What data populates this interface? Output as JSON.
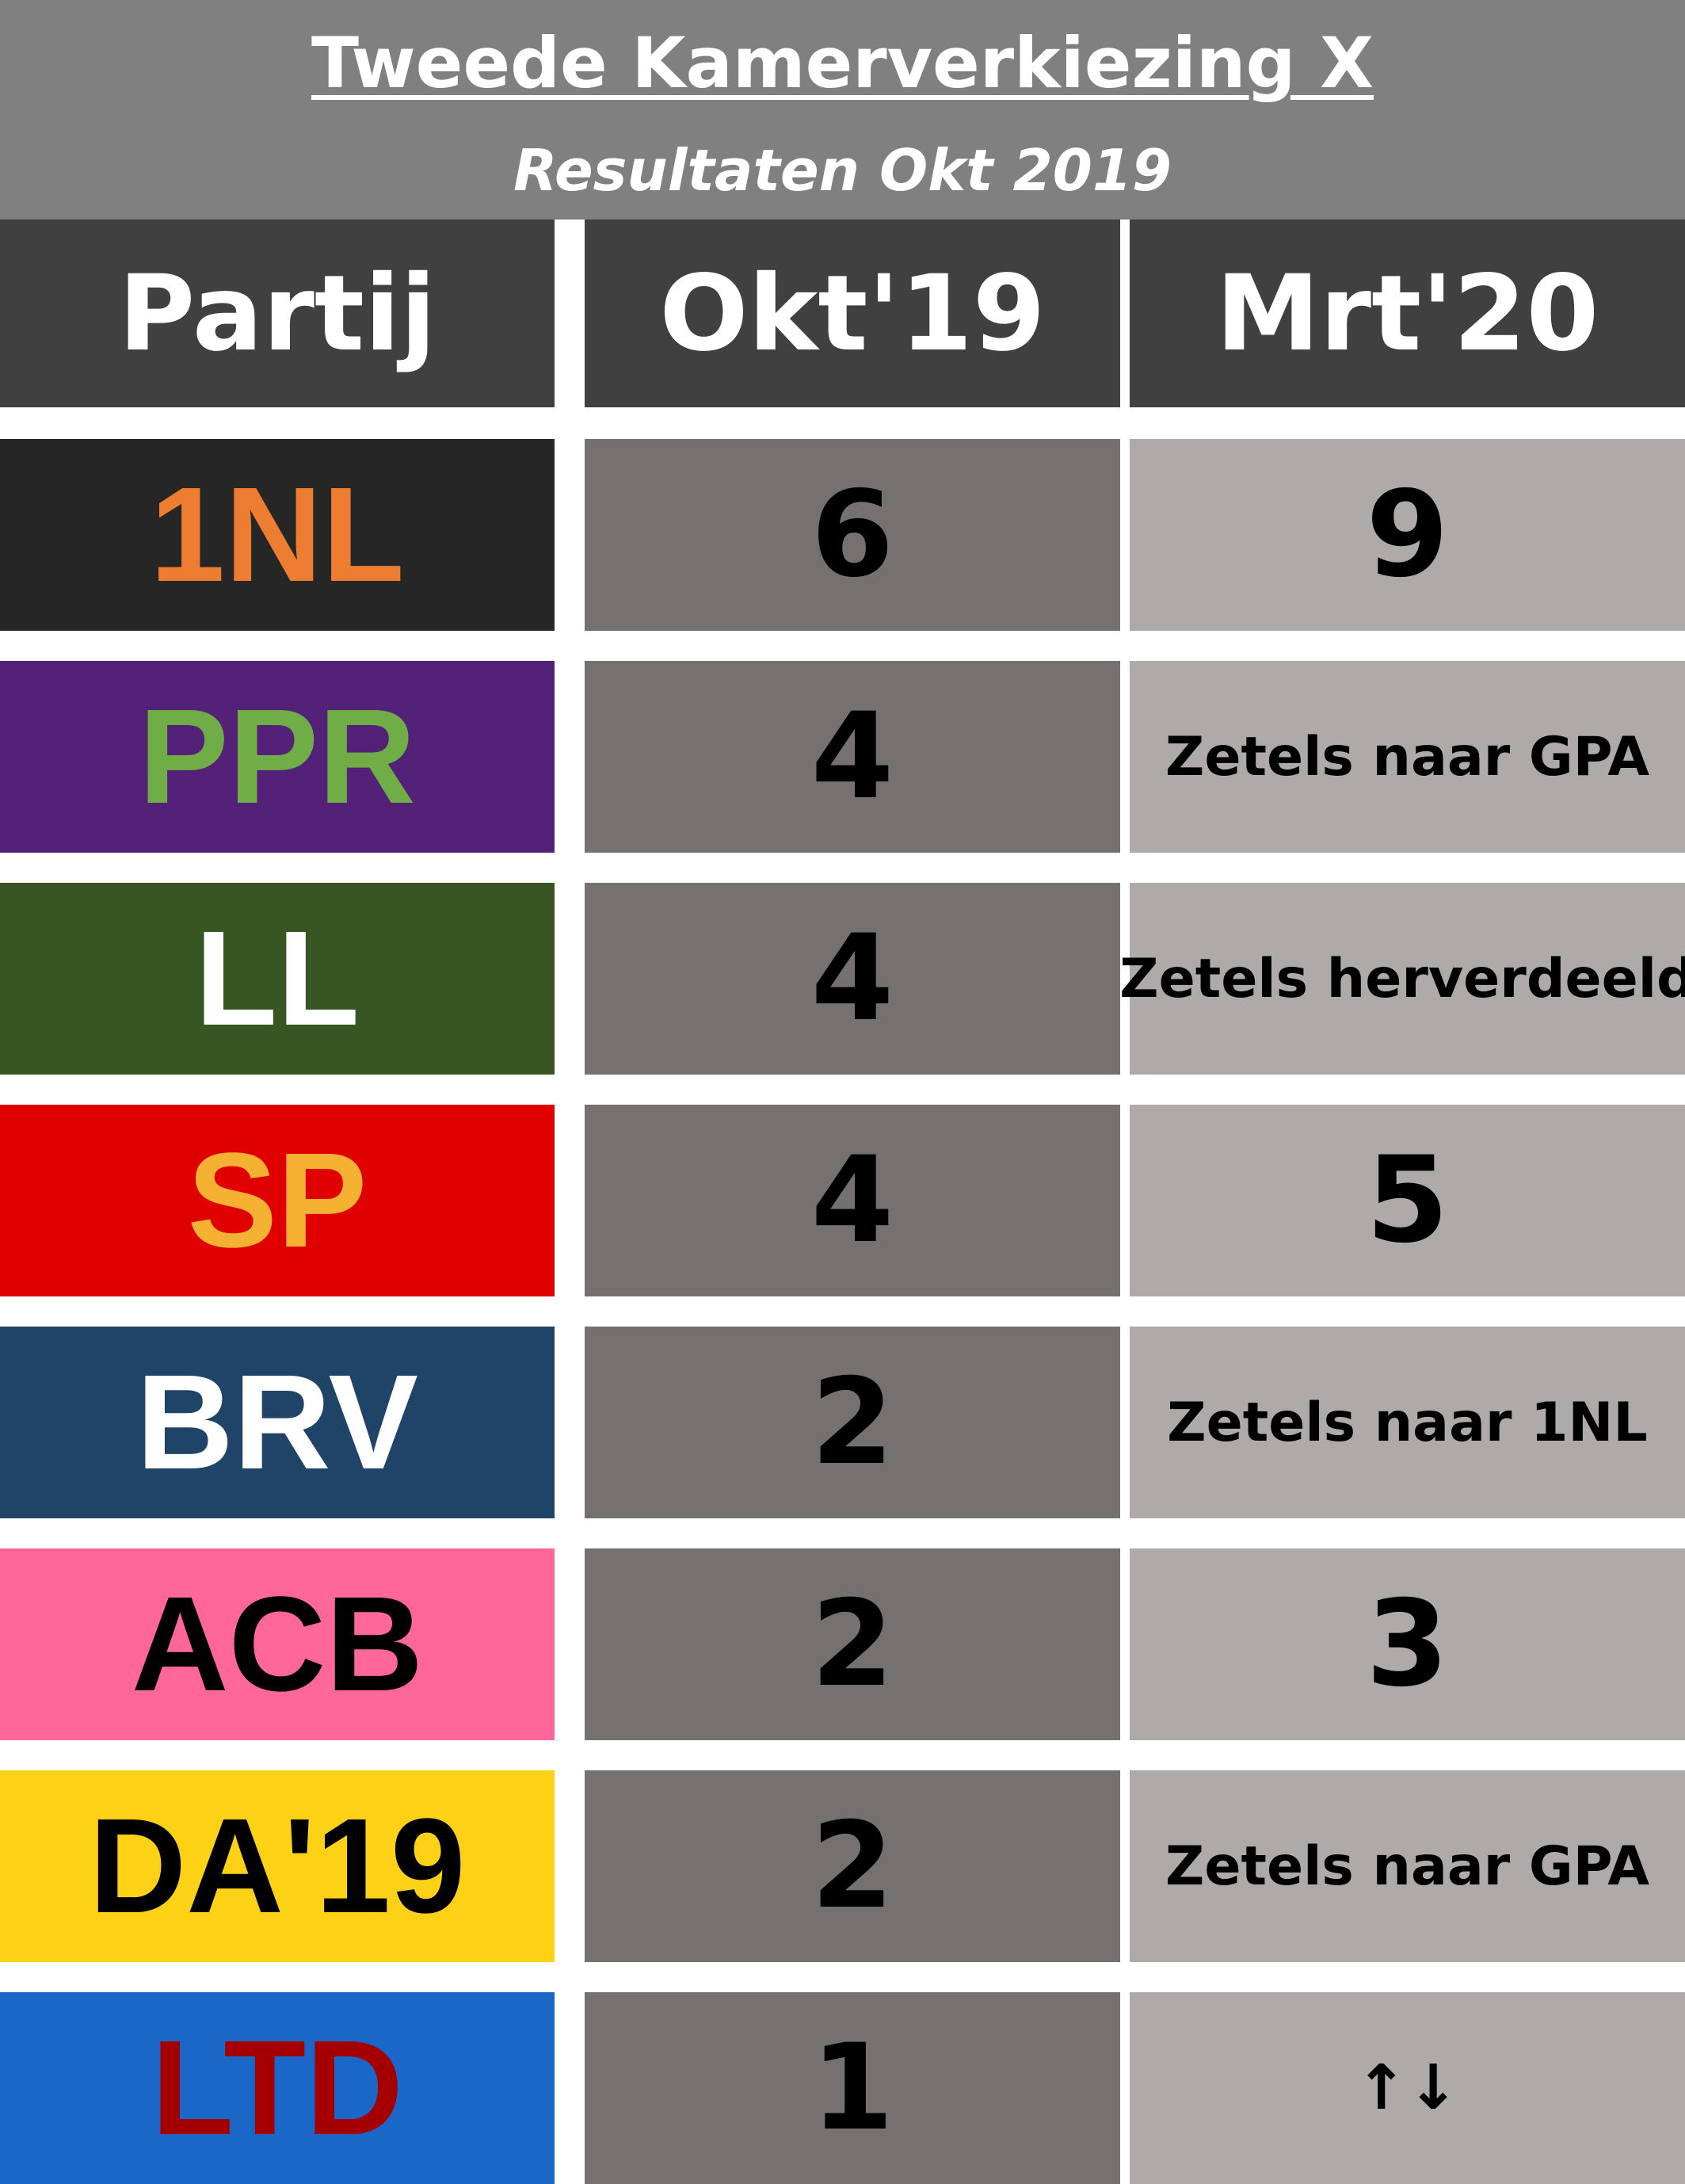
{
  "title": "Tweede Kamerverkiezing X",
  "subtitle": "Resultaten Okt 2019",
  "columns": [
    "Partij",
    "Okt'19",
    "Mrt'20"
  ],
  "rows": [
    {
      "party": "1NL",
      "bg": "#262626",
      "fg": "#ED7D31",
      "okt": "6",
      "mrt": "9",
      "mrt_style": "big"
    },
    {
      "party": "PPR",
      "bg": "#532278",
      "fg": "#70AD47",
      "okt": "4",
      "mrt": "Zetels naar GPA",
      "mrt_style": "small"
    },
    {
      "party": "LL",
      "bg": "#375623",
      "fg": "#FFFFFF",
      "okt": "4",
      "mrt": "Zetels herverdeeld",
      "mrt_style": "small"
    },
    {
      "party": "SP",
      "bg": "#E00000",
      "fg": "#F4B132",
      "okt": "4",
      "mrt": "5",
      "mrt_style": "big"
    },
    {
      "party": "BRV",
      "bg": "#1F4467",
      "fg": "#FFFFFF",
      "okt": "2",
      "mrt": "Zetels naar 1NL",
      "mrt_style": "small"
    },
    {
      "party": "ACB",
      "bg": "#FF6699",
      "fg": "#000000",
      "okt": "2",
      "mrt": "3",
      "mrt_style": "big"
    },
    {
      "party": "DA'19",
      "bg": "#FDD116",
      "fg": "#000000",
      "okt": "2",
      "mrt": "Zetels naar GPA",
      "mrt_style": "small"
    },
    {
      "party": "LTD",
      "bg": "#1A67C8",
      "fg": "#A50000",
      "okt": "1",
      "mrt": "↑↓",
      "mrt_style": "arrows"
    }
  ]
}
